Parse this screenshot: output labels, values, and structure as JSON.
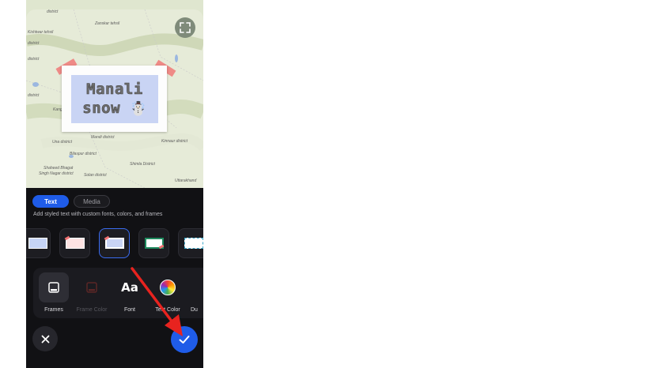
{
  "map": {
    "labels": [
      "district",
      "Zanskar tehsil",
      "Kishtwar tehsil",
      "district",
      "district",
      "Kangra",
      "district",
      "Una district",
      "Mandi district",
      "Kinnaur district",
      "Bilaspur district",
      "Shaheed Bhagat",
      "Singh Nagar district",
      "Solan district",
      "Shimla District",
      "Uttarakhand"
    ]
  },
  "sticker": {
    "line1": "Manali",
    "line2": "snow",
    "emoji": "☃️"
  },
  "tabs": {
    "text": "Text",
    "media": "Media"
  },
  "description": "Add styled text with custom fonts, colors, and frames",
  "tools": {
    "frames": "Frames",
    "frame_color": "Frame Color",
    "font": "Font",
    "font_glyph": "Aa",
    "text_color": "Text Color",
    "partial": "Du"
  },
  "colors": {
    "accent": "#1f5ce8",
    "annotation_arrow": "#e8231f"
  },
  "icons": {
    "close": "close-icon",
    "confirm": "check-icon",
    "fullscreen": "fullscreen-icon"
  }
}
